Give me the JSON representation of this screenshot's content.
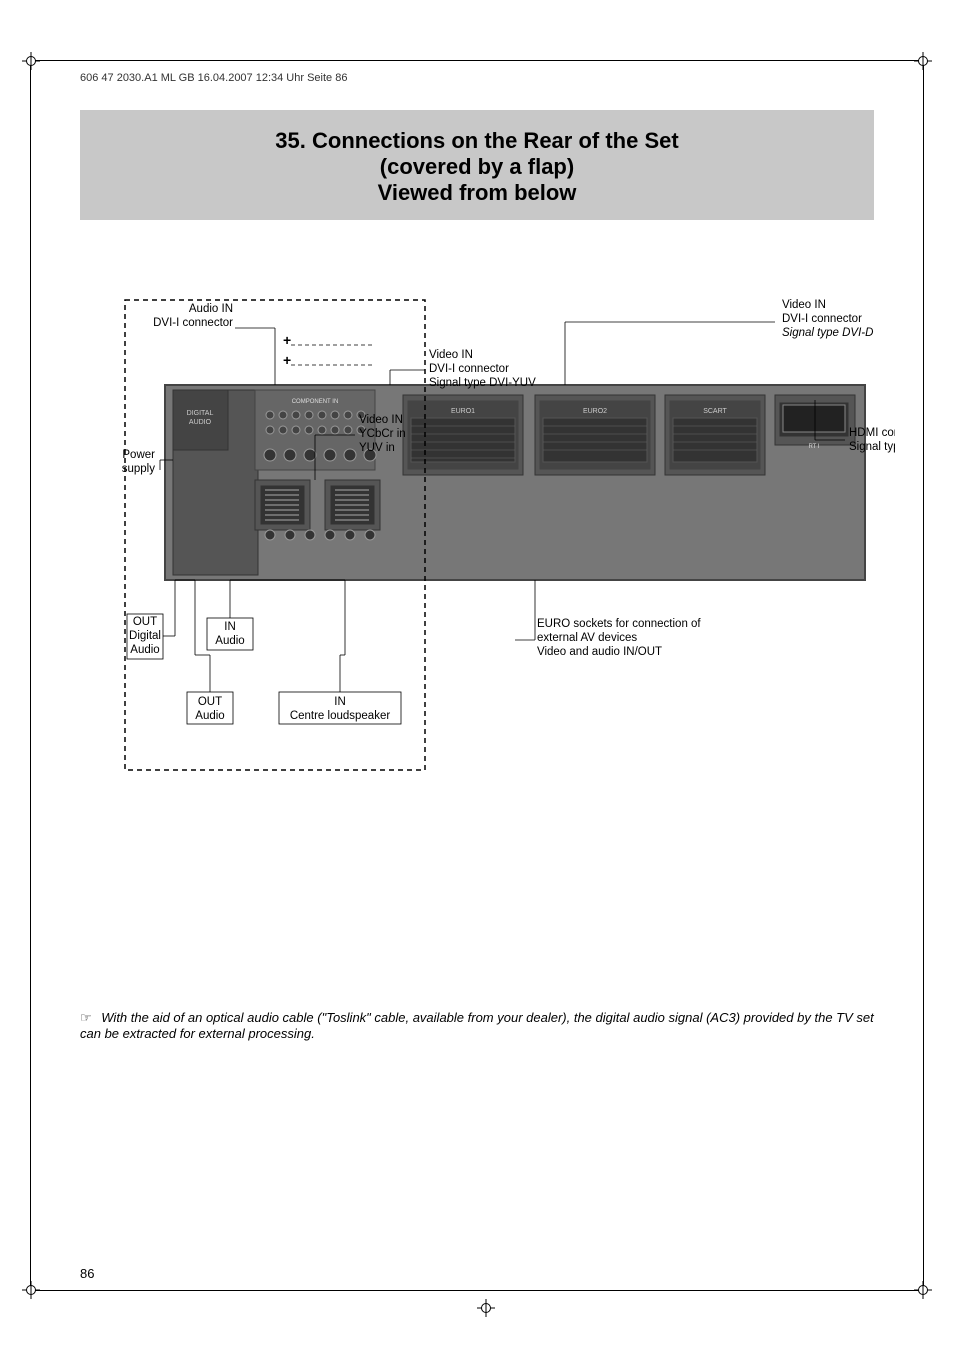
{
  "meta": {
    "line": "606 47 2030.A1   ML GB   16.04.2007   12:34 Uhr   Seite 86"
  },
  "title": {
    "line1": "35. Connections on the Rear of the Set",
    "line2": "(covered by a flap)",
    "line3": "Viewed from below"
  },
  "labels": {
    "audio_in_dvi": "Audio IN\nDVI-I connector",
    "video_in_dvi_d": "Video IN\nDVI-I connector\nSignal type DVI-D",
    "video_in_dvi_yuv": "Video IN\nDVI-I connector\nSignal type DVI-YUV",
    "power_supply": "Power\nsupply",
    "video_in_ycbcr": "Video IN\nYCbCr in\nYUV in",
    "hdmi_connector": "HDMI connector\nSignal type HDMI",
    "out_digital_audio": "OUT\nDigital\nAudio",
    "in_audio": "IN\nAudio",
    "euro_sockets": "EURO sockets for connection of\nexternal AV devices\nVideo and audio IN/OUT",
    "out_audio": "OUT\nAudio",
    "in_centre": "IN\nCentre loudspeaker"
  },
  "note": {
    "icon": "☞",
    "text": "With the aid of an optical audio cable (\"Toslink\" cable, available from your dealer), the digital audio signal (AC3) provided by the TV set can be extracted for external processing."
  },
  "page_number": "86"
}
